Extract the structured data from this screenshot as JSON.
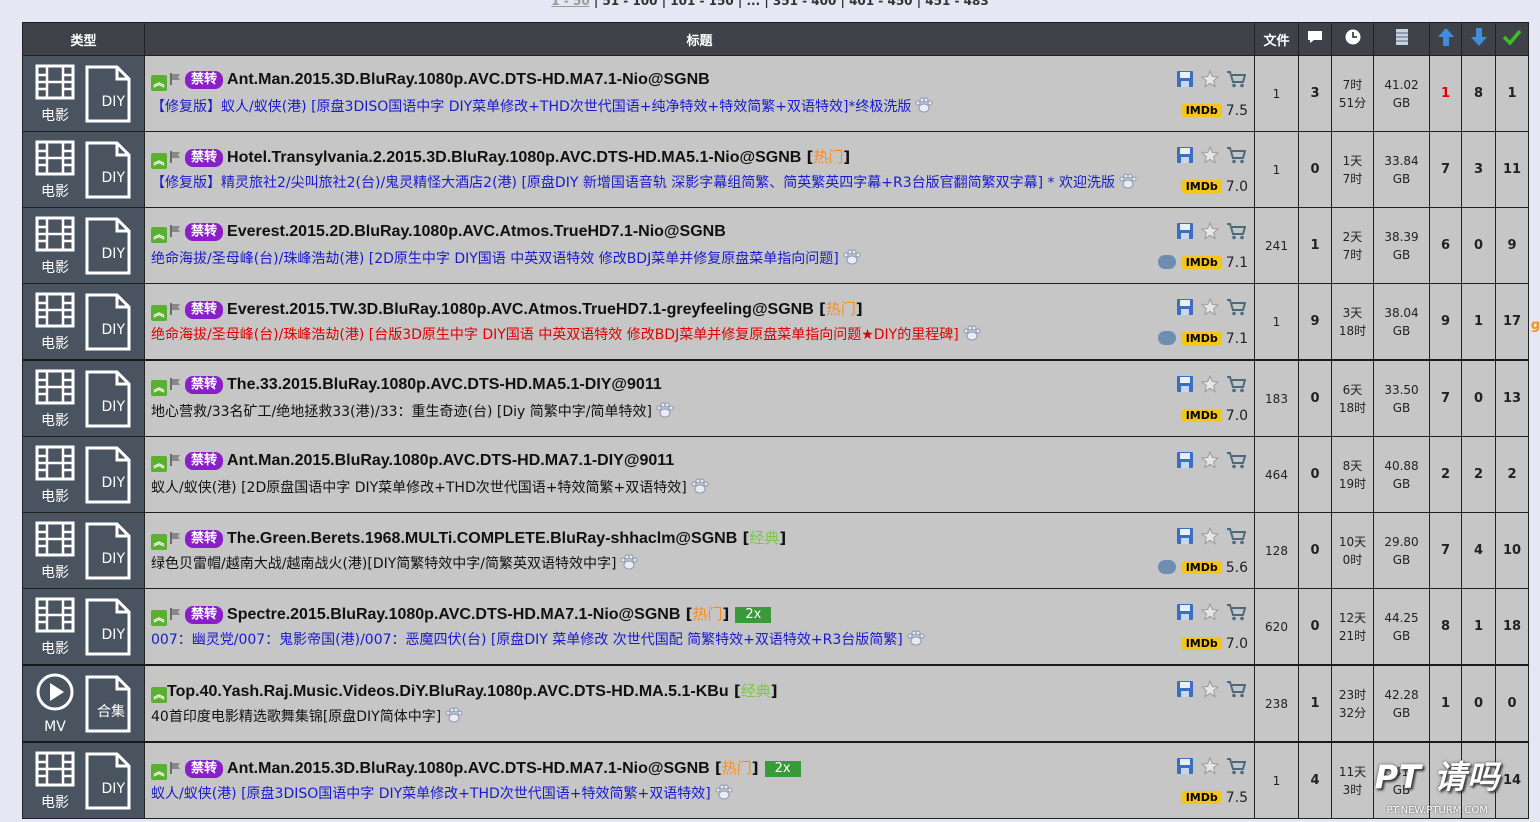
{
  "pager": {
    "current": "1 - 50",
    "links": [
      "51 - 100",
      "101 - 150",
      "...",
      "351 - 400",
      "401 - 450",
      "451 - 483"
    ]
  },
  "headers": {
    "type": "类型",
    "title": "标题",
    "files": "文件",
    "comments_icon": "comment-icon",
    "time_icon": "clock-icon",
    "size_icon": "size-icon",
    "seeders_icon": "arrow-up-icon",
    "leechers_icon": "arrow-down-icon",
    "completed_icon": "check-icon"
  },
  "rows": [
    {
      "cat": "电影",
      "sub": "DIY",
      "badge": "禁转",
      "name": "Ant.Man.2015.3D.BluRay.1080p.AVC.DTS-HD.MA7.1-Nio@SGNB",
      "tag": "",
      "tag_text": "",
      "x2": "",
      "sub_title": "【修复版】蚁人/蚁侠(港) [原盘3DISO国语中字 DIY菜单修改+THD次世代国语+纯净特效+特效简繁+双语特效]*终极洗版",
      "sub_color": "blue",
      "douban": false,
      "imdb": "7.5",
      "files": "1",
      "comments": "3",
      "time": [
        "7时",
        "51分"
      ],
      "size": [
        "41.02",
        "GB"
      ],
      "seeders": "1",
      "seeders_red": true,
      "leechers": "8",
      "completed": "1"
    },
    {
      "cat": "电影",
      "sub": "DIY",
      "badge": "禁转",
      "name": "Hotel.Transylvania.2.2015.3D.BluRay.1080p.AVC.DTS-HD.MA5.1-Nio@SGNB",
      "tag": "hot",
      "tag_text": "热门",
      "x2": "",
      "sub_title": "【修复版】精灵旅社2/尖叫旅社2(台)/鬼灵精怪大酒店2(港) [原盘DIY 新增国语音轨 深影字幕组简繁、简英繁英四字幕+R3台版官翻简繁双字幕] * 欢迎洗版",
      "sub_color": "blue",
      "douban": false,
      "imdb": "7.0",
      "files": "1",
      "comments": "0",
      "time": [
        "1天",
        "7时"
      ],
      "size": [
        "33.84",
        "GB"
      ],
      "seeders": "7",
      "seeders_red": false,
      "leechers": "3",
      "completed": "11"
    },
    {
      "cat": "电影",
      "sub": "DIY",
      "badge": "禁转",
      "name": "Everest.2015.2D.BluRay.1080p.AVC.Atmos.TrueHD7.1-Nio@SGNB",
      "tag": "",
      "tag_text": "",
      "x2": "",
      "sub_title": "绝命海拔/圣母峰(台)/珠峰浩劫(港) [2D原生中字 DIY国语 中英双语特效 修改BDJ菜单并修复原盘菜单指向问题]",
      "sub_color": "blue",
      "douban": true,
      "imdb": "7.1",
      "files": "241",
      "comments": "1",
      "time": [
        "2天",
        "7时"
      ],
      "size": [
        "38.39",
        "GB"
      ],
      "seeders": "6",
      "seeders_red": false,
      "leechers": "0",
      "completed": "9"
    },
    {
      "cat": "电影",
      "sub": "DIY",
      "badge": "禁转",
      "name": "Everest.2015.TW.3D.BluRay.1080p.AVC.Atmos.TrueHD7.1-greyfeeling@SGNB",
      "tag": "hot",
      "tag_text": "热门",
      "x2": "",
      "sub_title": "绝命海拔/圣母峰(台)/珠峰浩劫(港) [台版3D原生中字 DIY国语 中英双语特效 修改BDJ菜单并修复原盘菜单指向问题★DIY的里程碑]",
      "sub_color": "red",
      "douban": true,
      "imdb": "7.1",
      "files": "1",
      "comments": "9",
      "time": [
        "3天",
        "18时"
      ],
      "size": [
        "38.04",
        "GB"
      ],
      "seeders": "9",
      "seeders_red": false,
      "leechers": "1",
      "completed": "17"
    },
    {
      "cat": "电影",
      "sub": "DIY",
      "badge": "禁转",
      "name": "The.33.2015.BluRay.1080p.AVC.DTS-HD.MA5.1-DIY@9011",
      "tag": "",
      "tag_text": "",
      "x2": "",
      "sub_title": "地心营救/33名矿工/绝地拯救33(港)/33：重生奇迹(台) [Diy 简繁中字/简单特效]",
      "sub_color": "black",
      "douban": false,
      "imdb": "7.0",
      "files": "183",
      "comments": "0",
      "time": [
        "6天",
        "18时"
      ],
      "size": [
        "33.50",
        "GB"
      ],
      "seeders": "7",
      "seeders_red": false,
      "leechers": "0",
      "completed": "13"
    },
    {
      "cat": "电影",
      "sub": "DIY",
      "badge": "禁转",
      "name": "Ant.Man.2015.BluRay.1080p.AVC.DTS-HD.MA7.1-DIY@9011",
      "tag": "",
      "tag_text": "",
      "x2": "",
      "sub_title": "蚁人/蚁侠(港) [2D原盘国语中字 DIY菜单修改+THD次世代国语+特效简繁+双语特效]",
      "sub_color": "black",
      "douban": false,
      "imdb": "",
      "files": "464",
      "comments": "0",
      "time": [
        "8天",
        "19时"
      ],
      "size": [
        "40.88",
        "GB"
      ],
      "seeders": "2",
      "seeders_red": false,
      "leechers": "2",
      "completed": "2"
    },
    {
      "cat": "电影",
      "sub": "DIY",
      "badge": "禁转",
      "name": "The.Green.Berets.1968.MULTi.COMPLETE.BluRay-shhaclm@SGNB",
      "tag": "classic",
      "tag_text": "经典",
      "x2": "",
      "sub_title": "绿色贝雷帽/越南大战/越南战火(港)[DIY简繁特效中字/简繁英双语特效中字]",
      "sub_color": "black",
      "douban": true,
      "imdb": "5.6",
      "files": "128",
      "comments": "0",
      "time": [
        "10天",
        "0时"
      ],
      "size": [
        "29.80",
        "GB"
      ],
      "seeders": "7",
      "seeders_red": false,
      "leechers": "4",
      "completed": "10"
    },
    {
      "cat": "电影",
      "sub": "DIY",
      "badge": "禁转",
      "name": "Spectre.2015.BluRay.1080p.AVC.DTS-HD.MA7.1-Nio@SGNB",
      "tag": "hot",
      "tag_text": "热门",
      "x2": "2x",
      "sub_title": "007：幽灵党/007：鬼影帝国(港)/007：恶魔四伏(台) [原盘DIY 菜单修改 次世代国配 简繁特效+双语特效+R3台版简繁]",
      "sub_color": "blue",
      "douban": false,
      "imdb": "7.0",
      "files": "620",
      "comments": "0",
      "time": [
        "12天",
        "21时"
      ],
      "size": [
        "44.25",
        "GB"
      ],
      "seeders": "8",
      "seeders_red": false,
      "leechers": "1",
      "completed": "18"
    },
    {
      "cat": "MV",
      "sub": "合集",
      "badge": "",
      "name": "Top.40.Yash.Raj.Music.Videos.DiY.BluRay.1080p.AVC.DTS-HD.MA.5.1-KBu",
      "tag": "classic",
      "tag_text": "经典",
      "x2": "",
      "sub_title": "40首印度电影精选歌舞集锦[原盘DIY简体中字]",
      "sub_color": "black",
      "douban": false,
      "imdb": "",
      "files": "238",
      "comments": "1",
      "time": [
        "23时",
        "32分"
      ],
      "size": [
        "42.28",
        "GB"
      ],
      "seeders": "1",
      "seeders_red": false,
      "leechers": "0",
      "completed": "0"
    },
    {
      "cat": "电影",
      "sub": "DIY",
      "badge": "禁转",
      "name": "Ant.Man.2015.3D.BluRay.1080p.AVC.DTS-HD.MA7.1-Nio@SGNB",
      "tag": "hot",
      "tag_text": "热门",
      "x2": "2x",
      "sub_title": "蚁人/蚁侠(港) [原盘3DISO国语中字 DIY菜单修改+THD次世代国语+特效简繁+双语特效]",
      "sub_color": "blue",
      "douban": false,
      "imdb": "7.5",
      "files": "1",
      "comments": "4",
      "time": [
        "11天",
        "3时"
      ],
      "size": [
        "41",
        "GB"
      ],
      "seeders": "",
      "seeders_red": false,
      "leechers": "",
      "completed": "14"
    }
  ],
  "watermark": {
    "main": "PT 请吗",
    "sub": "PT.NEW.PTURM.COM"
  },
  "edge_char": "g",
  "colors": {
    "header_bg": "#3f4249",
    "row_bg": "#c6c6c6",
    "badge": "#8a1fc9",
    "hot": "#ff8c1a",
    "classic": "#7ac943",
    "link_blue": "#1a1acc",
    "red": "#e00000"
  }
}
